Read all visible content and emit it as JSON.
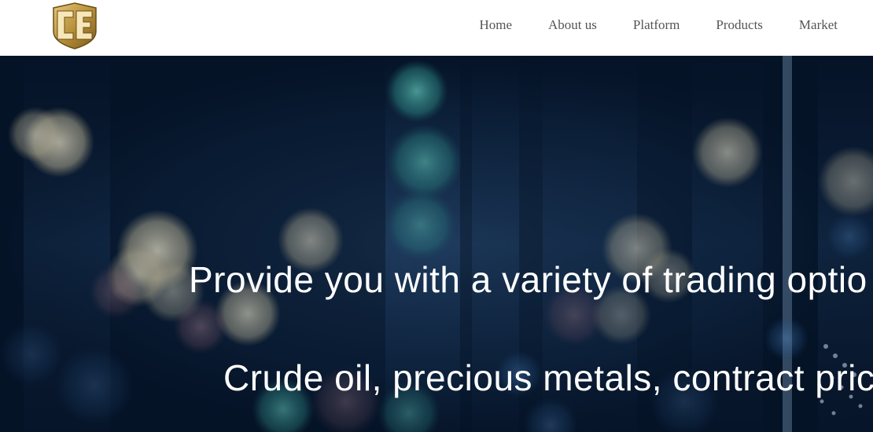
{
  "header": {
    "logo_text": "CE",
    "nav": [
      {
        "label": "Home"
      },
      {
        "label": "About us"
      },
      {
        "label": "Platform"
      },
      {
        "label": "Products"
      },
      {
        "label": "Market"
      }
    ]
  },
  "hero": {
    "headline": "Provide you with a variety of trading optio",
    "subheadline": "Crude oil, precious metals, contract price"
  },
  "colors": {
    "nav_text": "#555555",
    "logo_gold": "#b8913a",
    "hero_bg": "#071a30",
    "hero_text": "#ffffff"
  }
}
